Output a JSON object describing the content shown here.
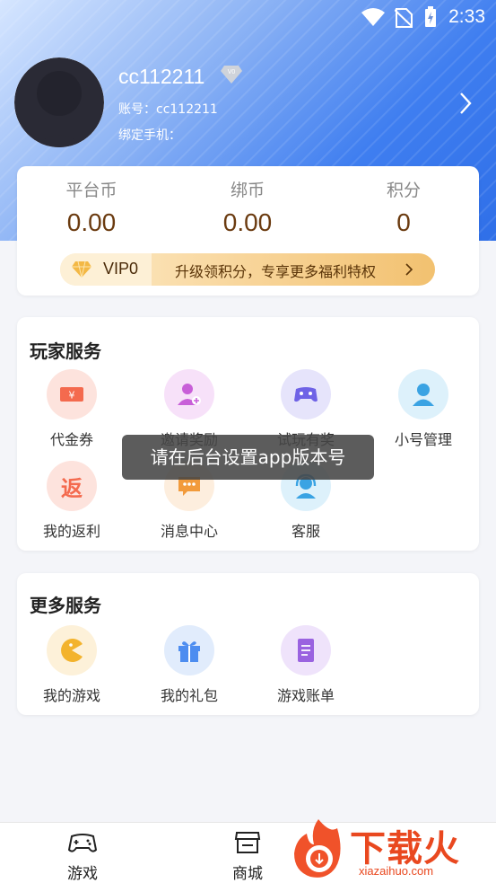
{
  "status_bar": {
    "time": "2:33"
  },
  "profile": {
    "username": "cc112211",
    "vip_badge": "V0",
    "account_label": "账号：cc112211",
    "phone_label": "绑定手机："
  },
  "wallet": {
    "platform_coin": {
      "label": "平台币",
      "value": "0.00"
    },
    "bound_coin": {
      "label": "绑币",
      "value": "0.00"
    },
    "points": {
      "label": "积分",
      "value": "0"
    },
    "vip": {
      "level": "VIP0",
      "promo": "升级领积分，专享更多福利特权"
    }
  },
  "player_services": {
    "title": "玩家服务",
    "items": [
      {
        "label": "代金券",
        "icon": "voucher-icon"
      },
      {
        "label": "邀请奖励",
        "icon": "invite-user-icon"
      },
      {
        "label": "试玩有奖",
        "icon": "gamepad-icon"
      },
      {
        "label": "小号管理",
        "icon": "user-icon"
      },
      {
        "label": "我的返利",
        "icon": "rebate-icon",
        "glyph": "返"
      },
      {
        "label": "消息中心",
        "icon": "message-icon"
      },
      {
        "label": "客服",
        "icon": "headset-icon"
      }
    ]
  },
  "more_services": {
    "title": "更多服务",
    "items": [
      {
        "label": "我的游戏",
        "icon": "pacman-icon"
      },
      {
        "label": "我的礼包",
        "icon": "gift-icon"
      },
      {
        "label": "游戏账单",
        "icon": "bill-icon"
      }
    ]
  },
  "toast": "请在后台设置app版本号",
  "tabbar": {
    "tabs": [
      {
        "label": "游戏",
        "icon": "gamepad-tab-icon"
      },
      {
        "label": "商城",
        "icon": "store-tab-icon"
      }
    ]
  },
  "watermark": {
    "title": "下载火",
    "url": "xiazaihuo.com"
  },
  "colors": {
    "accent": "#2f6fe8",
    "gold_text": "#6b3b10",
    "watermark": "#e9481f"
  }
}
